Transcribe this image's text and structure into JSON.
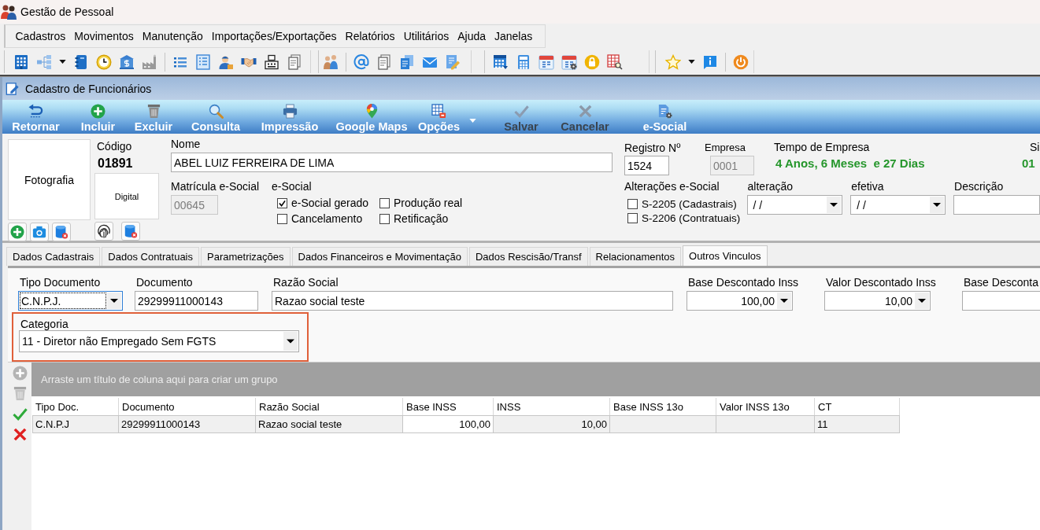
{
  "app": {
    "title": "Gestão de Pessoal"
  },
  "menu": [
    "Cadastros",
    "Movimentos",
    "Manutenção",
    "Importações/Exportações",
    "Relatórios",
    "Utilitários",
    "Ajuda",
    "Janelas"
  ],
  "window": {
    "title": "Cadastro de Funcionários"
  },
  "toolbar": [
    {
      "label": "Retornar",
      "disabled": false
    },
    {
      "label": "Incluir",
      "disabled": false
    },
    {
      "label": "Excluir",
      "disabled": false
    },
    {
      "label": "Consulta",
      "disabled": false
    },
    {
      "label": "Impressão",
      "disabled": false
    },
    {
      "label": "Google Maps",
      "disabled": false
    },
    {
      "label": "Opções",
      "disabled": false
    },
    {
      "label": "Salvar",
      "disabled": true
    },
    {
      "label": "Cancelar",
      "disabled": true
    },
    {
      "label": "e-Social",
      "disabled": false
    }
  ],
  "employee": {
    "photo": {
      "label": "Fotografia"
    },
    "code": {
      "label": "Código",
      "value": "01891"
    },
    "fingerprint": {
      "label": "Digital"
    },
    "name": {
      "label": "Nome",
      "value": "ABEL LUIZ FERREIRA DE LIMA"
    },
    "esocial_registration": {
      "label": "Matrícula e-Social",
      "value": "00645",
      "disabled": true
    },
    "esocial": {
      "label": "e-Social",
      "options": [
        {
          "label": "e-Social gerado",
          "checked": true
        },
        {
          "label": "Produção real",
          "checked": false
        },
        {
          "label": "Cancelamento",
          "checked": false
        },
        {
          "label": "Retificação",
          "checked": false
        }
      ]
    },
    "registration_number": {
      "label": "Registro Nº",
      "value": "1524",
      "disabled": false
    },
    "company": {
      "label": "Empresa",
      "value": "0001",
      "disabled": true
    },
    "tenure": {
      "label": "Tempo de Empresa",
      "value": "4 Anos, 6 Meses  e 27 Dias"
    },
    "field_5": {
      "label": "Si",
      "value": "01"
    },
    "esocial_changes": {
      "label": "Alterações e-Social",
      "options": [
        {
          "label": "S-2205 (Cadastrais)",
          "checked": false
        },
        {
          "label": "S-2206 (Contratuais)",
          "checked": false
        }
      ]
    },
    "change_date": {
      "label": "alteração",
      "value": "/ /"
    },
    "effective_date": {
      "label": "efetiva",
      "value": "/ /"
    },
    "description": {
      "label": "Descrição"
    }
  },
  "tabs": [
    {
      "label": "Dados Cadastrais",
      "selected": false
    },
    {
      "label": "Dados Contratuais",
      "selected": false
    },
    {
      "label": "Parametrizações",
      "selected": false
    },
    {
      "label": "Dados Financeiros e Movimentação",
      "selected": false
    },
    {
      "label": "Dados Rescisão/Transf",
      "selected": false
    },
    {
      "label": "Relacionamentos",
      "selected": false
    },
    {
      "label": "Outros Vinculos",
      "selected": true
    }
  ],
  "tab_panel": {
    "fields": [
      {
        "kind": "select",
        "label": "Tipo Documento",
        "value": "C.N.P.J.",
        "focused": true
      },
      {
        "kind": "text",
        "label": "Documento",
        "value": "29299911000143",
        "focused": false
      },
      {
        "kind": "text",
        "label": "Razão Social",
        "value": "Razao social teste",
        "focused": false
      },
      {
        "kind": "amount",
        "label": "Base Descontado Inss",
        "value": "100,00",
        "focused": false
      },
      {
        "kind": "amount",
        "label": "Valor Descontado Inss",
        "value": "10,00",
        "focused": false
      },
      {
        "kind": "text",
        "label": "Base Desconta",
        "focused": false
      }
    ],
    "category": {
      "label": "Categoria",
      "value": "11 - Diretor não Empregado Sem FGTS",
      "highlighted": true
    }
  },
  "grid": {
    "actions": [
      {
        "disabled": true
      },
      {
        "disabled": true
      },
      {
        "disabled": false
      },
      {
        "disabled": false
      }
    ],
    "group_hint": "Arraste um título de coluna aqui para criar um grupo",
    "columns": [
      {
        "label": "Tipo Doc.",
        "kind": "text"
      },
      {
        "label": "Documento",
        "kind": "text"
      },
      {
        "label": "Razão Social",
        "kind": "text"
      },
      {
        "label": "Base INSS",
        "kind": "number"
      },
      {
        "label": "INSS",
        "kind": "number"
      },
      {
        "label": "Base INSS 13o",
        "kind": "number"
      },
      {
        "label": "Valor INSS 13o",
        "kind": "number"
      },
      {
        "label": "CT",
        "kind": "text"
      }
    ],
    "rows": [
      {
        "cells": [
          {
            "text": "C.N.P.J",
            "focused": false
          },
          {
            "text": "29299911000143",
            "focused": false
          },
          {
            "text": "Razao social teste",
            "focused": false
          },
          {
            "text": "100,00",
            "focused": true
          },
          {
            "text": "10,00",
            "focused": false
          },
          {
            "focused": false
          },
          {
            "focused": false
          },
          {
            "text": "11",
            "focused": false
          }
        ]
      }
    ]
  }
}
